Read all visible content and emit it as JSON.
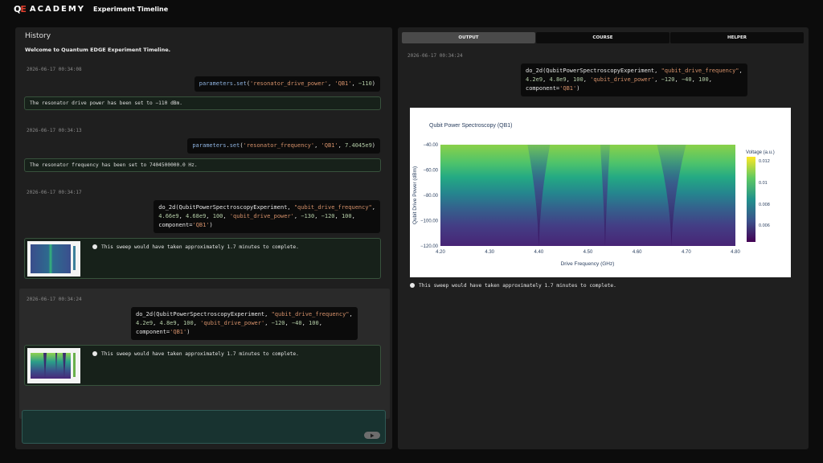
{
  "topbar": {
    "logo_mark": "QE",
    "logo_text": "ACADEMY",
    "app_title": "Experiment Timeline"
  },
  "history": {
    "title": "History",
    "welcome": "Welcome to Quantum EDGE Experiment Timeline.",
    "entries": [
      {
        "timestamp": "2026-06-17 00:34:08",
        "result": "The resonator drive power has been set to −110 dBm."
      },
      {
        "timestamp": "2026-06-17 00:34:13",
        "result": "The resonator frequency has been set to 7404500000.0 Hz."
      },
      {
        "timestamp": "2026-06-17 00:34:17",
        "result": "This sweep would have taken approximately 1.7 minutes to complete."
      },
      {
        "timestamp": "2026-06-17 00:34:24",
        "result": "This sweep would have taken approximately 1.7 minutes to complete."
      }
    ]
  },
  "input": {
    "send_icon": "play-icon"
  },
  "tabs": [
    "OUTPUT",
    "COURSE",
    "HELPER"
  ],
  "output": {
    "timestamp": "2026-06-17 00:34:24",
    "result": "This sweep would have taken approximately 1.7 minutes to complete."
  },
  "chart_data": {
    "type": "heatmap",
    "title": "Qubit Power Spectroscopy (QB1)",
    "xlabel": "Drive Frequency (GHz)",
    "ylabel": "Qubit Drive Power (dBm)",
    "x_ticks": [
      "4.20",
      "4.30",
      "4.40",
      "4.50",
      "4.60",
      "4.70",
      "4.80"
    ],
    "y_ticks": [
      "−40.00",
      "−60.00",
      "−80.00",
      "−100.00",
      "−120.00"
    ],
    "xlim": [
      4.2,
      4.8
    ],
    "ylim": [
      -120,
      -40
    ],
    "colorbar_label": "Voltage (a.u.)",
    "colorbar_ticks": [
      "0.012",
      "0.01",
      "0.008",
      "0.006"
    ],
    "colorscale": "viridis",
    "resonance_dips_ghz": [
      4.4,
      4.535,
      4.67
    ],
    "colors": {
      "viridis_low": "#440154",
      "viridis_mid": "#21918c",
      "viridis_high": "#fde725"
    }
  }
}
